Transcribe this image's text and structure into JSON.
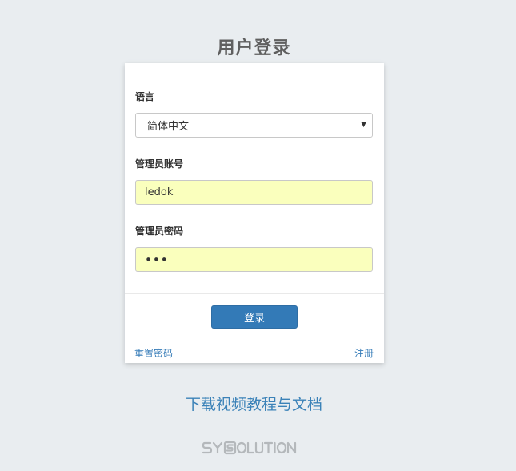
{
  "page": {
    "title": "用户登录"
  },
  "form": {
    "language_label": "语言",
    "language_value": "简体中文",
    "account_label": "管理员账号",
    "account_value": "ledok",
    "password_label": "管理员密码",
    "password_value": "•••",
    "login_label": "登录",
    "reset_password_label": "重置密码",
    "register_label": "注册"
  },
  "download": {
    "label": "下载视频教程与文档"
  },
  "logo": {
    "text": "SYSOLUTION",
    "color": "#b4b8bb"
  },
  "colors": {
    "accent": "#337ab7",
    "autofill": "#faffbd",
    "background": "#e9edf0"
  }
}
